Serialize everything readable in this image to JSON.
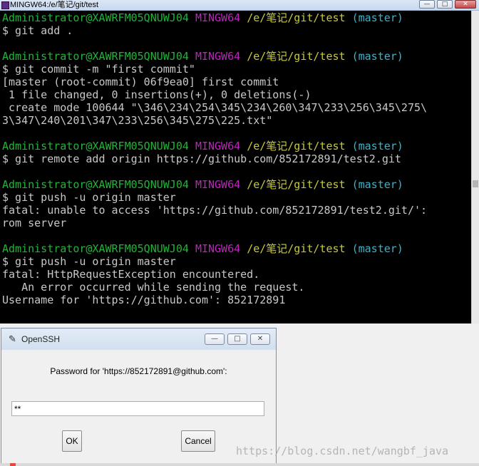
{
  "terminal": {
    "title": "MINGW64:/e/笔记/git/test",
    "controls": {
      "minimize": "—",
      "maximize": "□",
      "close": "✕"
    },
    "lines": [
      {
        "type": "prompt",
        "user": "Administrator@XAWRFM05QNUWJ04",
        "sys": "MINGW64",
        "path": "/e/笔记/git/test",
        "branch": "(master)"
      },
      {
        "type": "out",
        "text": "$ git add ."
      },
      {
        "type": "out",
        "text": ""
      },
      {
        "type": "prompt",
        "user": "Administrator@XAWRFM05QNUWJ04",
        "sys": "MINGW64",
        "path": "/e/笔记/git/test",
        "branch": "(master)"
      },
      {
        "type": "out",
        "text": "$ git commit -m \"first commit\""
      },
      {
        "type": "out",
        "text": "[master (root-commit) 06f9ea0] first commit"
      },
      {
        "type": "out",
        "text": " 1 file changed, 0 insertions(+), 0 deletions(-)"
      },
      {
        "type": "out",
        "text": " create mode 100644 \"\\346\\234\\254\\345\\234\\260\\347\\233\\256\\345\\275\\"
      },
      {
        "type": "out",
        "text": "3\\347\\240\\201\\347\\233\\256\\345\\275\\225.txt\""
      },
      {
        "type": "out",
        "text": ""
      },
      {
        "type": "prompt",
        "user": "Administrator@XAWRFM05QNUWJ04",
        "sys": "MINGW64",
        "path": "/e/笔记/git/test",
        "branch": "(master)"
      },
      {
        "type": "out",
        "text": "$ git remote add origin https://github.com/852172891/test2.git"
      },
      {
        "type": "out",
        "text": ""
      },
      {
        "type": "prompt",
        "user": "Administrator@XAWRFM05QNUWJ04",
        "sys": "MINGW64",
        "path": "/e/笔记/git/test",
        "branch": "(master)"
      },
      {
        "type": "out",
        "text": "$ git push -u origin master"
      },
      {
        "type": "out",
        "text": "fatal: unable to access 'https://github.com/852172891/test2.git/': "
      },
      {
        "type": "out",
        "text": "rom server"
      },
      {
        "type": "out",
        "text": ""
      },
      {
        "type": "prompt",
        "user": "Administrator@XAWRFM05QNUWJ04",
        "sys": "MINGW64",
        "path": "/e/笔记/git/test",
        "branch": "(master)"
      },
      {
        "type": "out",
        "text": "$ git push -u origin master"
      },
      {
        "type": "out",
        "text": "fatal: HttpRequestException encountered."
      },
      {
        "type": "out",
        "text": "   An error occurred while sending the request."
      },
      {
        "type": "out",
        "text": "Username for 'https://github.com': 852172891"
      }
    ]
  },
  "dialog": {
    "title": "OpenSSH",
    "controls": {
      "minimize": "—",
      "maximize": "□",
      "close": "✕"
    },
    "prompt": "Password for 'https://852172891@github.com':",
    "password_value": "**",
    "ok_label": "OK",
    "cancel_label": "Cancel"
  },
  "watermark": "https://blog.csdn.net/wangbf_java",
  "colors": {
    "user": "#23b23a",
    "sys": "#c51fc5",
    "path": "#c8c83a",
    "branch": "#3ab3c8",
    "output": "#c8c8c8",
    "terminal_bg": "#000000"
  },
  "icons": {
    "terminal": "mingw-terminal-icon",
    "dialog": "feather-icon"
  }
}
